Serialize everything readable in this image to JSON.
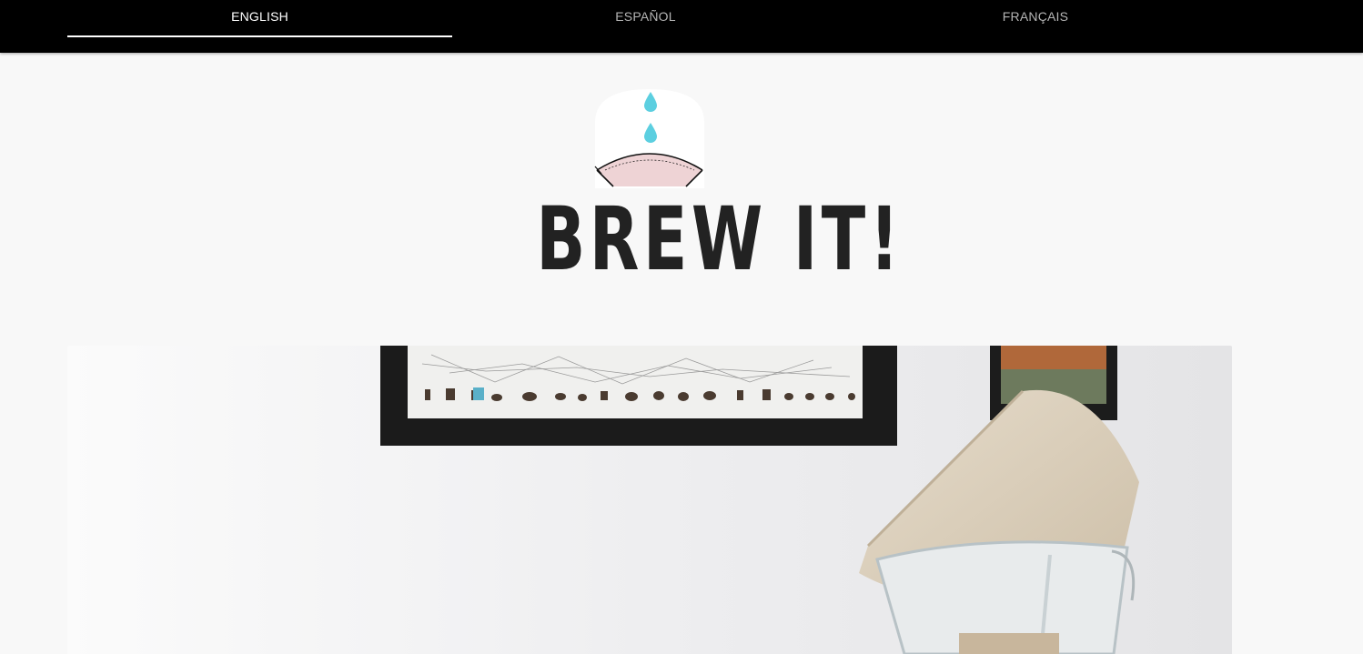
{
  "nav": {
    "tabs": [
      {
        "label": "ENGLISH",
        "active": true
      },
      {
        "label": "ESPAÑOL",
        "active": false
      },
      {
        "label": "FRANÇAIS",
        "active": false
      }
    ]
  },
  "brand": {
    "name": "BREW IT!",
    "logo_icon": "pour-over-filter-icon",
    "accent_drop_color": "#5ccfe0",
    "filter_color": "#eed3d5"
  },
  "hero": {
    "image": "coffee-pour-over-photo"
  }
}
